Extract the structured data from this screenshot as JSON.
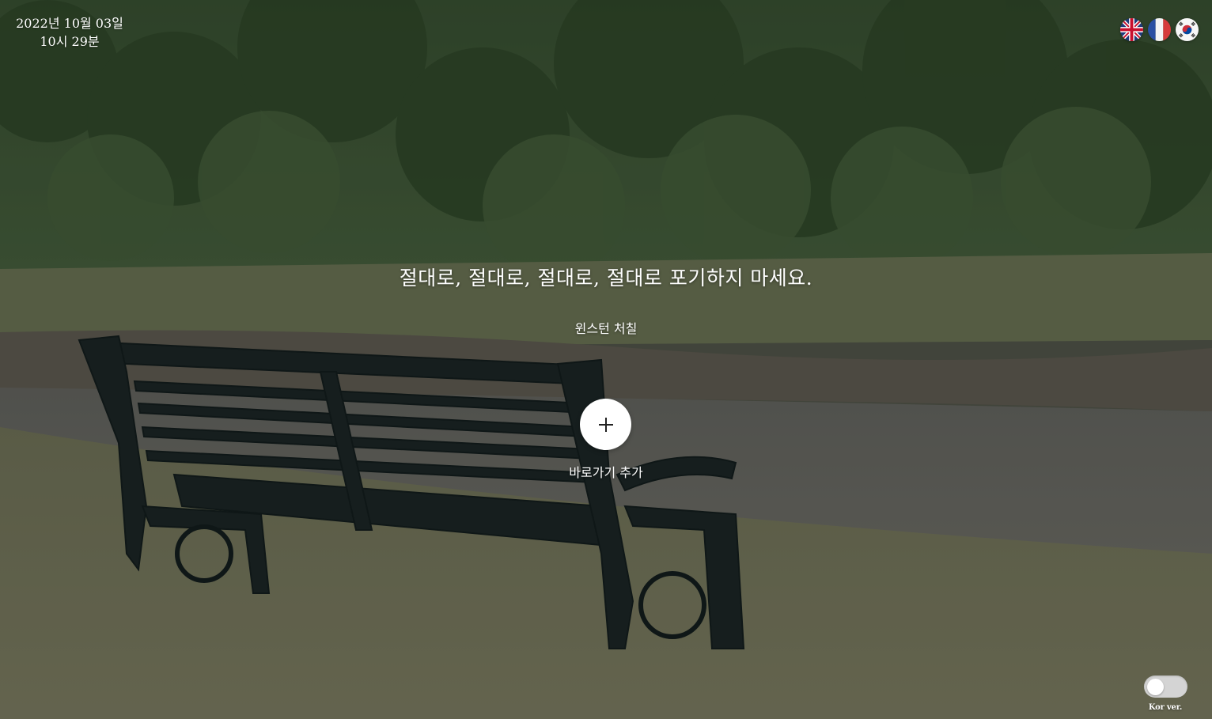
{
  "clock": {
    "date": "2022년 10월 03일",
    "time": "10시 29분"
  },
  "languages": [
    {
      "name": "English",
      "icon": "uk-flag-icon"
    },
    {
      "name": "Français",
      "icon": "france-flag-icon"
    },
    {
      "name": "한국어",
      "icon": "korea-flag-icon"
    }
  ],
  "quote": {
    "text": "절대로, 절대로, 절대로, 절대로 포기하지 마세요.",
    "author": "윈스턴 처칠"
  },
  "shortcut": {
    "icon": "plus-icon",
    "label": "바로가기 추가"
  },
  "language_toggle": {
    "label": "Kor ver.",
    "state": "off"
  },
  "colors": {
    "text": "#ffffff",
    "button_bg": "#ffffff",
    "toggle_track": "#d4d4d4"
  }
}
